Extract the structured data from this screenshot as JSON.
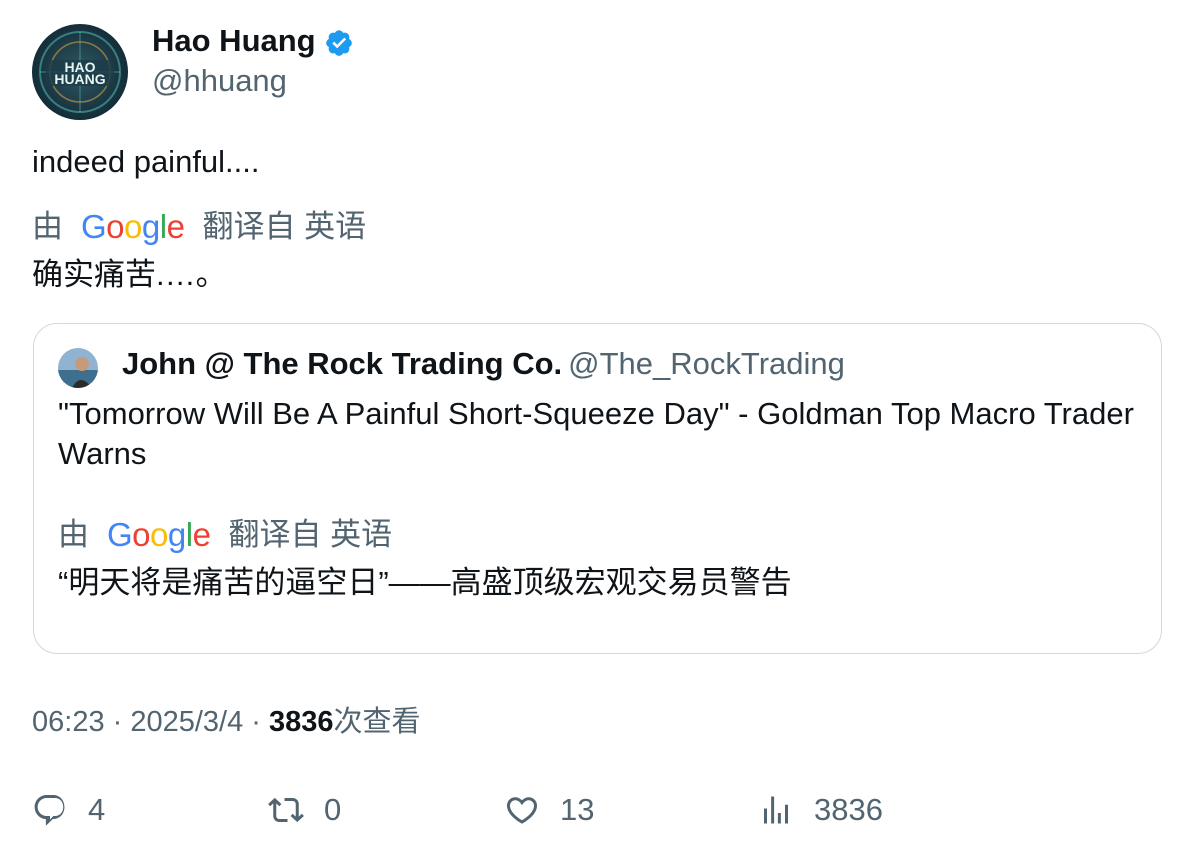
{
  "author": {
    "display_name": "Hao Huang",
    "handle": "@hhuang",
    "avatar_text_line1": "HAO",
    "avatar_text_line2": "HUANG",
    "verified": true
  },
  "tweet": {
    "text": "indeed painful....",
    "translated_by_prefix": "由",
    "translated_by_suffix": "翻译自 英语",
    "translation": "确实痛苦.…。"
  },
  "quote": {
    "display_name": "John @ The Rock Trading Co.",
    "handle": "@The_RockTrading",
    "text": "\"Tomorrow Will Be A Painful Short-Squeeze Day\" - Goldman Top Macro Trader Warns",
    "translated_by_prefix": "由",
    "translated_by_suffix": "翻译自 英语",
    "translation": "“明天将是痛苦的逼空日”——高盛顶级宏观交易员警告"
  },
  "meta": {
    "time": "06:23",
    "date": "2025/3/4",
    "views_count": "3836",
    "views_label": "次查看"
  },
  "actions": {
    "replies": "4",
    "retweets": "0",
    "likes": "13",
    "views": "3836"
  },
  "colors": {
    "secondary_text": "#536471",
    "border": "#cfd9de",
    "verified": "#1d9bf0"
  }
}
